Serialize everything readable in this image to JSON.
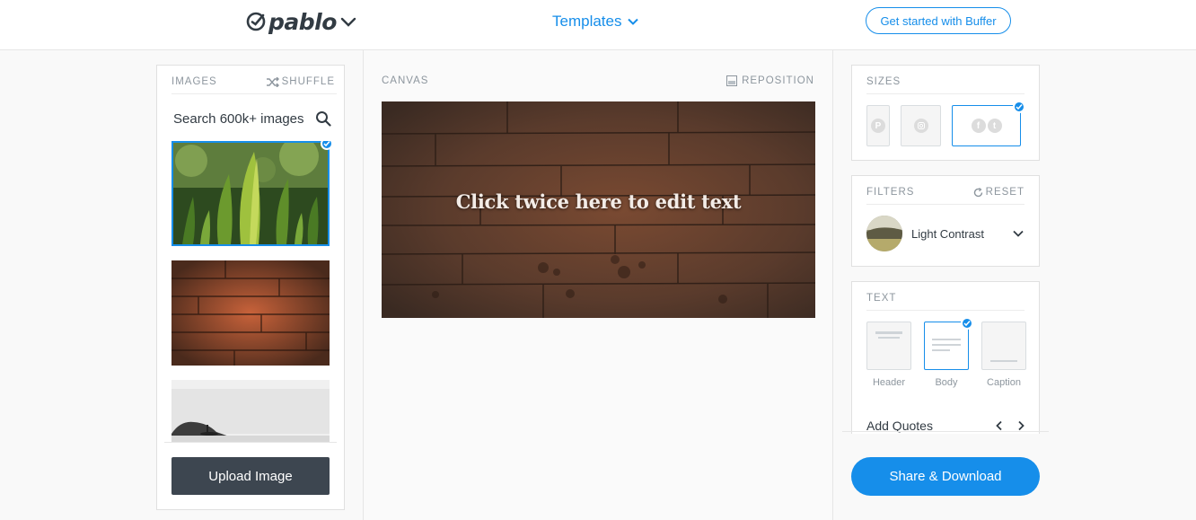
{
  "header": {
    "logo_text": "pablo",
    "templates_label": "Templates",
    "get_started_label": "Get started with Buffer"
  },
  "images_panel": {
    "title": "IMAGES",
    "shuffle_label": "SHUFFLE",
    "search_placeholder": "Search 600k+ images",
    "thumbnails": [
      {
        "name": "green-plant-leaves",
        "selected": true
      },
      {
        "name": "wooden-planks",
        "selected": false
      },
      {
        "name": "misty-coast",
        "selected": false
      }
    ],
    "upload_label": "Upload Image"
  },
  "canvas": {
    "title": "CANVAS",
    "reposition_label": "REPOSITION",
    "overlay_text": "Click twice here to edit text"
  },
  "sizes": {
    "title": "SIZES",
    "options": [
      {
        "name": "pinterest",
        "selected": false
      },
      {
        "name": "instagram",
        "selected": false
      },
      {
        "name": "facebook-twitter",
        "selected": true
      }
    ]
  },
  "filters": {
    "title": "FILTERS",
    "reset_label": "RESET",
    "selected": "Light Contrast"
  },
  "text": {
    "title": "TEXT",
    "options": [
      {
        "label": "Header",
        "selected": false
      },
      {
        "label": "Body",
        "selected": true
      },
      {
        "label": "Caption",
        "selected": false
      }
    ],
    "add_quotes_label": "Add Quotes"
  },
  "share_label": "Share & Download",
  "colors": {
    "accent": "#168eea",
    "dark_button": "#3d4650"
  }
}
